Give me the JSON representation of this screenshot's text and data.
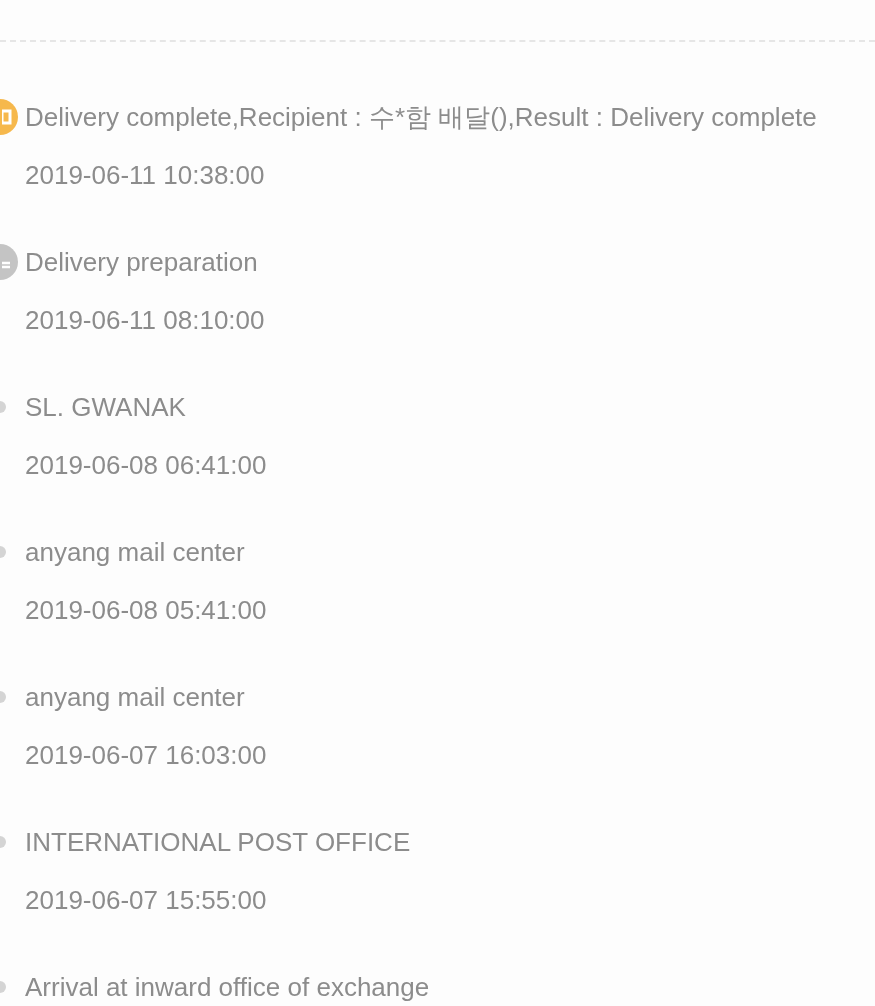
{
  "events": [
    {
      "kind": "delivered",
      "status": "Delivery complete,Recipient : 수*함 배달(),Result : Delivery complete",
      "time": "2019-06-11 10:38:00"
    },
    {
      "kind": "preparing",
      "status": "Delivery preparation",
      "time": "2019-06-11 08:10:00"
    },
    {
      "kind": "step",
      "status": "SL. GWANAK",
      "time": "2019-06-08 06:41:00"
    },
    {
      "kind": "step",
      "status": "anyang mail center",
      "time": "2019-06-08 05:41:00"
    },
    {
      "kind": "step",
      "status": "anyang mail center",
      "time": "2019-06-07 16:03:00"
    },
    {
      "kind": "step",
      "status": "INTERNATIONAL POST OFFICE",
      "time": "2019-06-07 15:55:00"
    },
    {
      "kind": "step",
      "status": "Arrival at inward office of exchange"
    }
  ]
}
